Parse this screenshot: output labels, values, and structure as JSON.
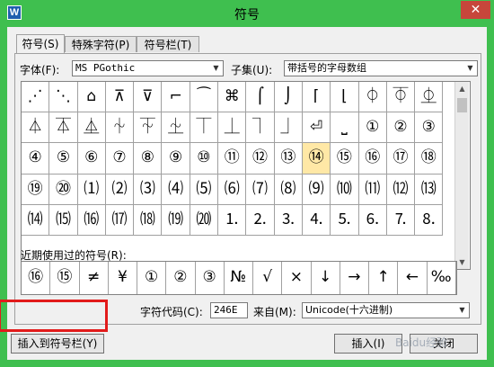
{
  "app": {
    "icon_letter": "W",
    "title": "符号",
    "close_label": "✕"
  },
  "tabs": [
    {
      "label": "符号(S)"
    },
    {
      "label": "特殊字符(P)"
    },
    {
      "label": "符号栏(T)"
    }
  ],
  "font": {
    "label": "字体(F):",
    "value": "MS PGothic"
  },
  "subset": {
    "label": "子集(U):",
    "value": "带括号的字母数组"
  },
  "symbols": [
    "⋰",
    "⋱",
    "⌂",
    "⊼",
    "⊽",
    "⌐",
    "⁀",
    "⌘",
    "⌠",
    "⌡",
    "⌈",
    "⌊",
    "⏀",
    "⏁",
    "⏂",
    "⏃",
    "⏄",
    "⏅",
    "⏆",
    "⏇",
    "⏈",
    "⏉",
    "⏊",
    "⏋",
    "⏌",
    "⏎",
    "⎵",
    "①",
    "②",
    "③",
    "④",
    "⑤",
    "⑥",
    "⑦",
    "⑧",
    "⑨",
    "⑩",
    "⑪",
    "⑫",
    "⑬",
    "⑭",
    "⑮",
    "⑯",
    "⑰",
    "⑱",
    "⑲",
    "⑳",
    "⑴",
    "⑵",
    "⑶",
    "⑷",
    "⑸",
    "⑹",
    "⑺",
    "⑻",
    "⑼",
    "⑽",
    "⑾",
    "⑿",
    "⒀",
    "⒁",
    "⒂",
    "⒃",
    "⒄",
    "⒅",
    "⒆",
    "⒇",
    "⒈",
    "⒉",
    "⒊",
    "⒋",
    "⒌",
    "⒍",
    "⒎",
    "⒏"
  ],
  "selected_index": 40,
  "recent": {
    "label": "近期使用过的符号(R):",
    "symbols": [
      "⑯",
      "⑮",
      "≠",
      "¥",
      "①",
      "②",
      "③",
      "№",
      "√",
      "×",
      "↓",
      "→",
      "↑",
      "←",
      "‰"
    ]
  },
  "char_code": {
    "label": "字符代码(C):",
    "value": "246E"
  },
  "from": {
    "label": "来自(M):",
    "value": "Unicode(十六进制)"
  },
  "buttons": {
    "insert_to_bar": "插入到符号栏(Y)",
    "insert": "插入(I)",
    "close": "关闭"
  },
  "watermark": "Baidu经验"
}
